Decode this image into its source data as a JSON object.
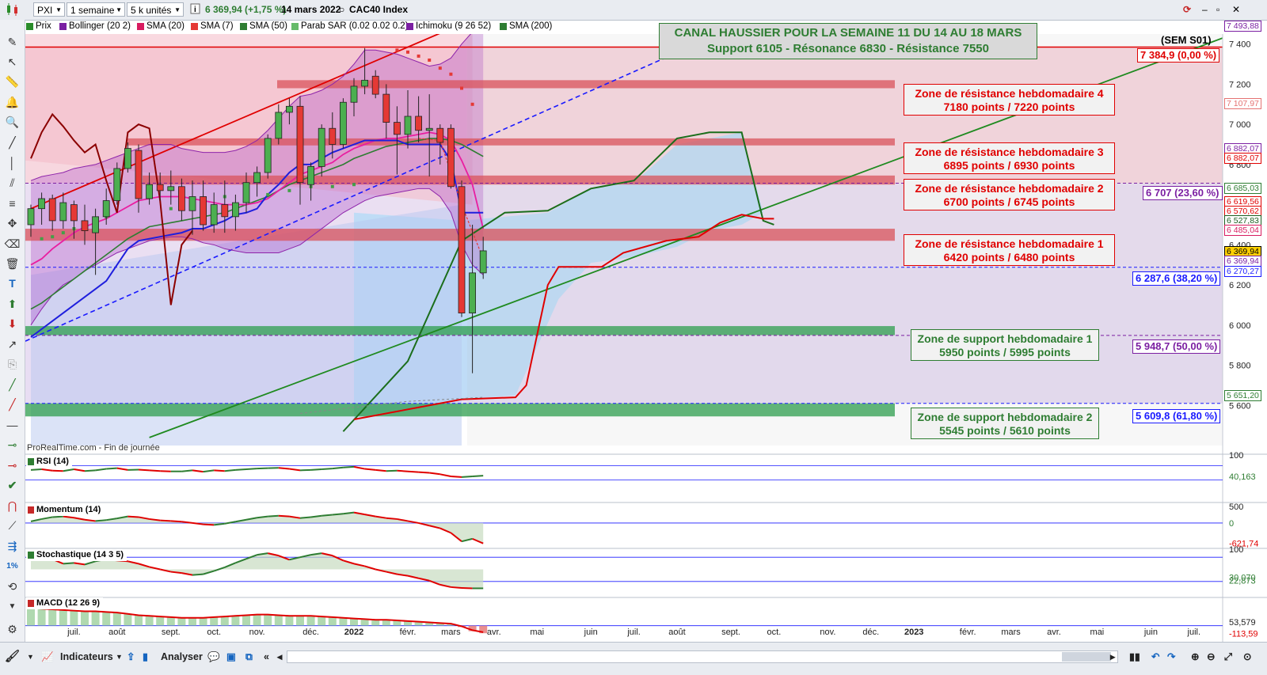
{
  "toolbar": {
    "symbol": "PXI",
    "period": "1 semaine",
    "units": "5 k unités",
    "price_change": "6 369,94 (+1,75 %)",
    "date": "14 mars 2022",
    "instrument": "CAC40 Index"
  },
  "legend": [
    {
      "label": "Prix",
      "color": "#2a8c2a"
    },
    {
      "label": "Bollinger (20 2)",
      "color": "#7a1fa2"
    },
    {
      "label": "SMA (20)",
      "color": "#d81b60"
    },
    {
      "label": "SMA (7)",
      "color": "#e53935"
    },
    {
      "label": "SMA (50)",
      "color": "#2e7d32"
    },
    {
      "label": "Parab SAR (0.02 0.02 0.2)",
      "color": "#43a047"
    },
    {
      "label": "Ichimoku (9 26 52)",
      "color": "#7b1fa2"
    },
    {
      "label": "SMA (200)",
      "color": "#2e7d32"
    }
  ],
  "annotations": {
    "title_line1": "CANAL HAUSSIER POUR LA SEMAINE 11 DU 14 AU 18 MARS",
    "title_line2": "Support 6105 - Résonance 6830 - Résistance 7550",
    "sem_label": "(SEM S01)",
    "watermark": "ProRealTime.com - Fin de journée",
    "zones": [
      {
        "line1": "Zone de résistance hebdomadaire 4",
        "line2": "7180 points / 7220 points",
        "kind": "resistance"
      },
      {
        "line1": "Zone de résistance hebdomadaire 3",
        "line2": "6895 points / 6930 points",
        "kind": "resistance"
      },
      {
        "line1": "Zone de résistance hebdomadaire 2",
        "line2": "6700 points / 6745 points",
        "kind": "resistance"
      },
      {
        "line1": "Zone de résistance hebdomadaire 1",
        "line2": "6420 points / 6480 points",
        "kind": "resistance"
      },
      {
        "line1": "Zone de support hebdomadaire 1",
        "line2": "5950 points / 5995 points",
        "kind": "support"
      },
      {
        "line1": "Zone de support hebdomadaire 2",
        "line2": "5545 points / 5610 points",
        "kind": "support"
      }
    ],
    "line_labels": [
      {
        "text": "7 384,9 (0,00 %)",
        "color": "#e00000"
      },
      {
        "text": "6 707 (23,60 %)",
        "color": "#7b1fa2"
      },
      {
        "text": "6 287,6 (38,20 %)",
        "color": "#1a1aff"
      },
      {
        "text": "5 948,7 (50,00 %)",
        "color": "#7b1fa2"
      },
      {
        "text": "5 609,8 (61,80 %)",
        "color": "#1a1aff"
      }
    ],
    "price_tags": [
      {
        "text": "7 493,88",
        "value": 7493.88,
        "color": "#7b1fa2"
      },
      {
        "text": "7 107,97",
        "value": 7107.97,
        "color": "#e57373"
      },
      {
        "text": "6 882,07",
        "value": 6882.07,
        "color": "#7b1fa2"
      },
      {
        "text": "6 882,07",
        "value": 6882.07,
        "color": "#e00000"
      },
      {
        "text": "6 685,03",
        "value": 6685.03,
        "color": "#2e7d32"
      },
      {
        "text": "6 619,56",
        "value": 6619.56,
        "color": "#e00000"
      },
      {
        "text": "6 570,62",
        "value": 6570.62,
        "color": "#e00000"
      },
      {
        "text": "6 527,83",
        "value": 6527.83,
        "color": "#1b5e20"
      },
      {
        "text": "6 485,04",
        "value": 6485.04,
        "color": "#d81b60"
      },
      {
        "text": "6 369,94",
        "value": 6369.94,
        "color": "#000000"
      },
      {
        "text": "6 369,94",
        "value": 6369.94,
        "color": "#7b1fa2"
      },
      {
        "text": "6 270,27",
        "value": 6270.27,
        "color": "#1a1aff"
      },
      {
        "text": "5 651,20",
        "value": 5651.2,
        "color": "#2e7d32"
      }
    ]
  },
  "bottombar": {
    "indicators_label": "Indicateurs",
    "analyze_label": "Analyser"
  },
  "chart_data": [
    {
      "type": "candlestick",
      "title": "PXI",
      "xlabel": "",
      "ylabel": "",
      "ylim": [
        5400,
        7450
      ],
      "y_ticks": [
        "7 400",
        "7 200",
        "7 000",
        "6 800",
        "6 600",
        "6 400",
        "6 200",
        "6 000",
        "5 800",
        "5 600"
      ],
      "y_tick_values": [
        7400,
        7200,
        7000,
        6800,
        6600,
        6400,
        6200,
        6000,
        5800,
        5600
      ],
      "x_ticks": [
        "juil.",
        "août",
        "sept.",
        "oct.",
        "nov.",
        "déc.",
        "2022",
        "févr.",
        "mars",
        "avr.",
        "mai",
        "juin",
        "juil.",
        "août",
        "sept.",
        "oct.",
        "nov.",
        "déc.",
        "2023",
        "févr.",
        "mars",
        "avr.",
        "mai",
        "juin",
        "juil."
      ],
      "x_tick_weeks": [
        4,
        8,
        13,
        17,
        21,
        26,
        30,
        35,
        39,
        43,
        47,
        52,
        56,
        60,
        65,
        69,
        74,
        78,
        82,
        87,
        91,
        95,
        99,
        104,
        108
      ],
      "candles": [
        {
          "o": 6500,
          "h": 6600,
          "l": 6440,
          "c": 6580
        },
        {
          "o": 6580,
          "h": 6660,
          "l": 6500,
          "c": 6630
        },
        {
          "o": 6630,
          "h": 6650,
          "l": 6470,
          "c": 6520
        },
        {
          "o": 6520,
          "h": 6660,
          "l": 6480,
          "c": 6610
        },
        {
          "o": 6600,
          "h": 6620,
          "l": 6430,
          "c": 6520
        },
        {
          "o": 6520,
          "h": 6600,
          "l": 6400,
          "c": 6470
        },
        {
          "o": 6460,
          "h": 6580,
          "l": 6250,
          "c": 6540
        },
        {
          "o": 6540,
          "h": 6680,
          "l": 6500,
          "c": 6620
        },
        {
          "o": 6620,
          "h": 6810,
          "l": 6600,
          "c": 6780
        },
        {
          "o": 6780,
          "h": 6910,
          "l": 6760,
          "c": 6880
        },
        {
          "o": 6870,
          "h": 6900,
          "l": 6560,
          "c": 6630
        },
        {
          "o": 6630,
          "h": 6760,
          "l": 6600,
          "c": 6700
        },
        {
          "o": 6700,
          "h": 6760,
          "l": 6620,
          "c": 6670
        },
        {
          "o": 6670,
          "h": 6770,
          "l": 6600,
          "c": 6690
        },
        {
          "o": 6690,
          "h": 6730,
          "l": 6520,
          "c": 6570
        },
        {
          "o": 6570,
          "h": 6720,
          "l": 6450,
          "c": 6640
        },
        {
          "o": 6640,
          "h": 6720,
          "l": 6470,
          "c": 6500
        },
        {
          "o": 6500,
          "h": 6660,
          "l": 6460,
          "c": 6600
        },
        {
          "o": 6600,
          "h": 6720,
          "l": 6460,
          "c": 6540
        },
        {
          "o": 6540,
          "h": 6650,
          "l": 6470,
          "c": 6610
        },
        {
          "o": 6610,
          "h": 6760,
          "l": 6560,
          "c": 6710
        },
        {
          "o": 6710,
          "h": 6790,
          "l": 6640,
          "c": 6760
        },
        {
          "o": 6760,
          "h": 6950,
          "l": 6730,
          "c": 6930
        },
        {
          "o": 6930,
          "h": 7100,
          "l": 6900,
          "c": 7060
        },
        {
          "o": 7060,
          "h": 7130,
          "l": 7000,
          "c": 7090
        },
        {
          "o": 7090,
          "h": 7140,
          "l": 6600,
          "c": 6710
        },
        {
          "o": 6700,
          "h": 6810,
          "l": 6620,
          "c": 6790
        },
        {
          "o": 6790,
          "h": 7000,
          "l": 6740,
          "c": 6980
        },
        {
          "o": 6980,
          "h": 7060,
          "l": 6830,
          "c": 6900
        },
        {
          "o": 6900,
          "h": 7130,
          "l": 6880,
          "c": 7110
        },
        {
          "o": 7110,
          "h": 7230,
          "l": 7040,
          "c": 7190
        },
        {
          "o": 7190,
          "h": 7380,
          "l": 7150,
          "c": 7220
        },
        {
          "o": 7240,
          "h": 7270,
          "l": 7130,
          "c": 7150
        },
        {
          "o": 7150,
          "h": 7200,
          "l": 6930,
          "c": 7010
        },
        {
          "o": 7010,
          "h": 7090,
          "l": 6750,
          "c": 6950
        },
        {
          "o": 6950,
          "h": 7170,
          "l": 6880,
          "c": 7040
        },
        {
          "o": 7040,
          "h": 7140,
          "l": 6910,
          "c": 6970
        },
        {
          "o": 6970,
          "h": 7150,
          "l": 6740,
          "c": 6980
        },
        {
          "o": 6980,
          "h": 7000,
          "l": 6800,
          "c": 6910
        },
        {
          "o": 6980,
          "h": 7000,
          "l": 6680,
          "c": 6690
        },
        {
          "o": 6690,
          "h": 6720,
          "l": 6040,
          "c": 6060
        },
        {
          "o": 6060,
          "h": 6500,
          "l": 5760,
          "c": 6260
        },
        {
          "o": 6260,
          "h": 6440,
          "l": 6230,
          "c": 6370
        }
      ],
      "overlays": {
        "bollinger_upper": [
          6720,
          6740,
          6750,
          6760,
          6780,
          6790,
          6800,
          6820,
          6840,
          6860,
          6880,
          6900,
          6900,
          6900,
          6880,
          6870,
          6860,
          6860,
          6860,
          6870,
          6890,
          6920,
          6970,
          7030,
          7090,
          7140,
          7150,
          7170,
          7200,
          7240,
          7300,
          7370,
          7370,
          7360,
          7350,
          7330,
          7310,
          7290,
          7300,
          7330,
          7400,
          7460,
          7490
        ],
        "bollinger_lower": [
          6000,
          6080,
          6150,
          6200,
          6230,
          6270,
          6300,
          6330,
          6360,
          6380,
          6400,
          6420,
          6430,
          6440,
          6440,
          6430,
          6410,
          6400,
          6380,
          6370,
          6360,
          6360,
          6360,
          6360,
          6380,
          6400,
          6440,
          6480,
          6520,
          6560,
          6590,
          6620,
          6640,
          6650,
          6660,
          6670,
          6680,
          6680,
          6640,
          6560,
          6400,
          6300,
          6250
        ],
        "sma20": [
          6300,
          6330,
          6380,
          6420,
          6460,
          6490,
          6510,
          6530,
          6560,
          6590,
          6620,
          6630,
          6640,
          6640,
          6640,
          6630,
          6620,
          6610,
          6600,
          6600,
          6600,
          6610,
          6630,
          6670,
          6710,
          6750,
          6770,
          6790,
          6810,
          6850,
          6880,
          6900,
          6920,
          6930,
          6930,
          6940,
          6950,
          6960,
          6950,
          6920,
          6820,
          6700,
          6480
        ],
        "sma50": [
          6080,
          6110,
          6150,
          6190,
          6230,
          6270,
          6310,
          6350,
          6390,
          6430,
          6460,
          6490,
          6500,
          6510,
          6520,
          6530,
          6540,
          6550,
          6560,
          6580,
          6600,
          6620,
          6640,
          6670,
          6700,
          6720,
          6740,
          6760,
          6780,
          6800,
          6830,
          6850,
          6870,
          6890,
          6900,
          6910,
          6920,
          6930,
          6930,
          6920,
          6900,
          6870,
          6840
        ]
      }
    },
    {
      "type": "line",
      "title": "RSI (14)",
      "ylim": [
        0,
        100
      ],
      "y_ticks": [
        "100",
        "40,163"
      ],
      "series": [
        {
          "name": "RSI (14)",
          "values": [
            58,
            60,
            56,
            55,
            60,
            55,
            57,
            61,
            63,
            58,
            59,
            57,
            55,
            54,
            54,
            57,
            53,
            57,
            55,
            58,
            60,
            62,
            63,
            64,
            61,
            57,
            58,
            60,
            62,
            65,
            67,
            61,
            58,
            55,
            56,
            54,
            52,
            50,
            46,
            40,
            38,
            40,
            42
          ]
        }
      ]
    },
    {
      "type": "line",
      "title": "Momentum (14)",
      "ylim": [
        -700,
        600
      ],
      "y_ticks": [
        "500",
        "0",
        "-621,74"
      ],
      "series": [
        {
          "name": "Momentum (14)",
          "values": [
            50,
            120,
            180,
            200,
            160,
            100,
            60,
            90,
            140,
            200,
            180,
            120,
            80,
            60,
            40,
            0,
            -40,
            -60,
            -20,
            40,
            100,
            160,
            200,
            220,
            200,
            150,
            180,
            220,
            250,
            280,
            320,
            260,
            200,
            150,
            120,
            60,
            0,
            -80,
            -160,
            -300,
            -560,
            -480,
            -620
          ]
        }
      ]
    },
    {
      "type": "line",
      "title": "Stochastique (14 3 5)",
      "ylim": [
        0,
        100
      ],
      "y_ticks": [
        "100",
        "30,070",
        "22,873"
      ],
      "series": [
        {
          "name": "Stochastique (14 3 5)",
          "values": [
            78,
            85,
            75,
            64,
            66,
            62,
            70,
            75,
            72,
            70,
            64,
            56,
            50,
            44,
            41,
            36,
            38,
            46,
            55,
            66,
            76,
            86,
            90,
            84,
            74,
            80,
            86,
            90,
            84,
            72,
            64,
            58,
            50,
            44,
            38,
            34,
            28,
            22,
            12,
            6,
            4,
            3,
            3
          ]
        }
      ]
    },
    {
      "type": "bar",
      "title": "MACD (12 26 9)",
      "ylim": [
        -200,
        400
      ],
      "y_ticks": [
        "53,579",
        "-113,59"
      ],
      "series": [
        {
          "name": "MACD (12 26 9)",
          "values": [
            260,
            250,
            240,
            230,
            220,
            210,
            210,
            200,
            190,
            170,
            150,
            140,
            130,
            120,
            110,
            110,
            110,
            120,
            130,
            140,
            150,
            160,
            160,
            150,
            140,
            140,
            140,
            130,
            120,
            110,
            100,
            90,
            80,
            80,
            70,
            60,
            50,
            40,
            30,
            20,
            -20,
            -80,
            -110
          ]
        }
      ]
    }
  ]
}
